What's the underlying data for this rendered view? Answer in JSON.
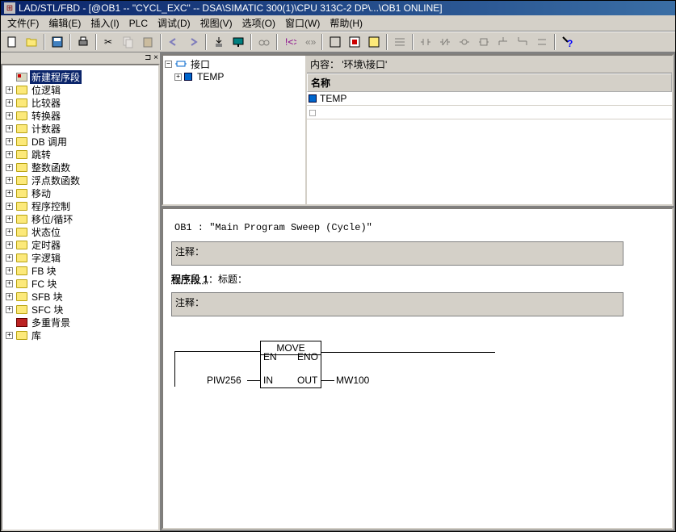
{
  "title": "LAD/STL/FBD  - [@OB1 -- \"CYCL_EXC\" -- DSA\\SIMATIC 300(1)\\CPU 313C-2 DP\\...\\OB1  ONLINE]",
  "menu": [
    "文件(F)",
    "编辑(E)",
    "插入(I)",
    "PLC",
    "调试(D)",
    "视图(V)",
    "选项(O)",
    "窗口(W)",
    "帮助(H)"
  ],
  "left_tree": [
    {
      "icon": "stamp",
      "label": "新建程序段",
      "sel": true,
      "toggle": ""
    },
    {
      "icon": "folder",
      "label": "位逻辑",
      "toggle": "+"
    },
    {
      "icon": "folder",
      "label": "比较器",
      "toggle": "+"
    },
    {
      "icon": "folder",
      "label": "转换器",
      "toggle": "+"
    },
    {
      "icon": "folder",
      "label": "计数器",
      "toggle": "+"
    },
    {
      "icon": "folder",
      "label": "DB 调用",
      "toggle": "+"
    },
    {
      "icon": "folder",
      "label": "跳转",
      "toggle": "+"
    },
    {
      "icon": "folder",
      "label": "整数函数",
      "toggle": "+"
    },
    {
      "icon": "folder",
      "label": "浮点数函数",
      "toggle": "+"
    },
    {
      "icon": "folder",
      "label": "移动",
      "toggle": "+"
    },
    {
      "icon": "folder",
      "label": "程序控制",
      "toggle": "+"
    },
    {
      "icon": "folder",
      "label": "移位/循环",
      "toggle": "+"
    },
    {
      "icon": "folder",
      "label": "状态位",
      "toggle": "+"
    },
    {
      "icon": "folder",
      "label": "定时器",
      "toggle": "+"
    },
    {
      "icon": "folder",
      "label": "字逻辑",
      "toggle": "+"
    },
    {
      "icon": "folder",
      "label": "FB 块",
      "toggle": "+"
    },
    {
      "icon": "folder",
      "label": "FC 块",
      "toggle": "+"
    },
    {
      "icon": "folder",
      "label": "SFB 块",
      "toggle": "+"
    },
    {
      "icon": "folder",
      "label": "SFC 块",
      "toggle": "+"
    },
    {
      "icon": "red",
      "label": "多重背景",
      "toggle": ""
    },
    {
      "icon": "folder",
      "label": "库",
      "toggle": "+"
    }
  ],
  "interface_panel": {
    "root": "接口",
    "child": "TEMP",
    "header_path": "内容：  '环境\\接口'",
    "col_name": "名称",
    "row1": "TEMP"
  },
  "editor": {
    "ob_line": "OB1 : \"Main Program Sweep (Cycle)\"",
    "comment_label": "注释：",
    "network_label": "程序段 1",
    "network_title": "：标题：",
    "comment2_label": "注释：",
    "block": {
      "name": "MOVE",
      "en": "EN",
      "eno": "ENO",
      "in": "IN",
      "out": "OUT",
      "in_val": "PIW256",
      "out_val": "MW100"
    }
  }
}
